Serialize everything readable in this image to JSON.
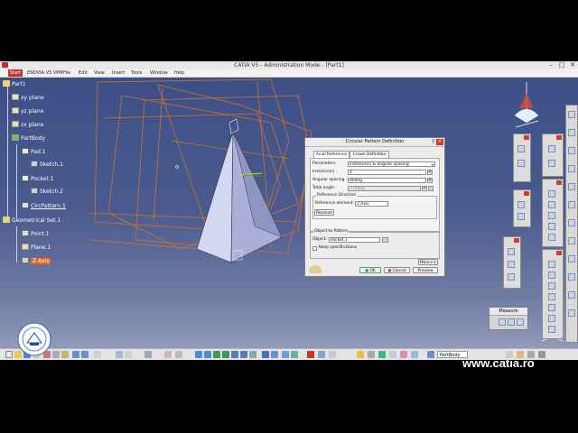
{
  "window": {
    "title": "CATIA V5 - Administration Mode - [Part1]",
    "minimize": "–",
    "maximize": "□",
    "close": "✕"
  },
  "menubar": {
    "start": "Start",
    "items": [
      "ENOVIA V5 VPM",
      "File",
      "Edit",
      "View",
      "Insert",
      "Tools",
      "Window",
      "Help"
    ]
  },
  "tree": {
    "root": "Part1",
    "xy": "xy plane",
    "yz": "yz plane",
    "zx": "zx plane",
    "partbody": "PartBody",
    "pad": "Pad.1",
    "sketch1": "Sketch.1",
    "pocket": "Pocket.1",
    "sketch2": "Sketch.2",
    "circpattern": "CircPattern.1",
    "geoset": "Geometrical Set.1",
    "point": "Point.1",
    "plane": "Plane.1",
    "zaxis": "Z Axis"
  },
  "dialog": {
    "title": "Circular Pattern Definition",
    "help": "?",
    "close": "✕",
    "tab_axial": "Axial Reference",
    "tab_crown": "Crown Definition",
    "parameters_label": "Parameters:",
    "parameters_value": "Instance(s) & angular spacing",
    "instances_label": "Instance(s) :",
    "instances_value": "4",
    "angular_label": "Angular spacing :",
    "angular_value": "90deg",
    "total_label": "Total angle :",
    "total_value": "270deg",
    "refdir_title": "Reference Direction",
    "refelem_label": "Reference element:",
    "refelem_value": "Z Axis",
    "reverse": "Reverse",
    "obj_title": "Object to Pattern",
    "object_label": "Object:",
    "object_value": "Pocket.1",
    "keep_spec": "Keep specifications",
    "more": "More>>",
    "ok": "OK",
    "cancel": "Cancel",
    "preview": "Preview"
  },
  "measure": {
    "title": "Measure"
  },
  "bottom": {
    "combo": "PartBody"
  },
  "watermark": "www.catia.ro",
  "colors": {
    "viewport_top": "#3c4f86",
    "wire": "#d2732a",
    "pyramid": "#c9cfee",
    "close_red": "#d33a2c"
  }
}
